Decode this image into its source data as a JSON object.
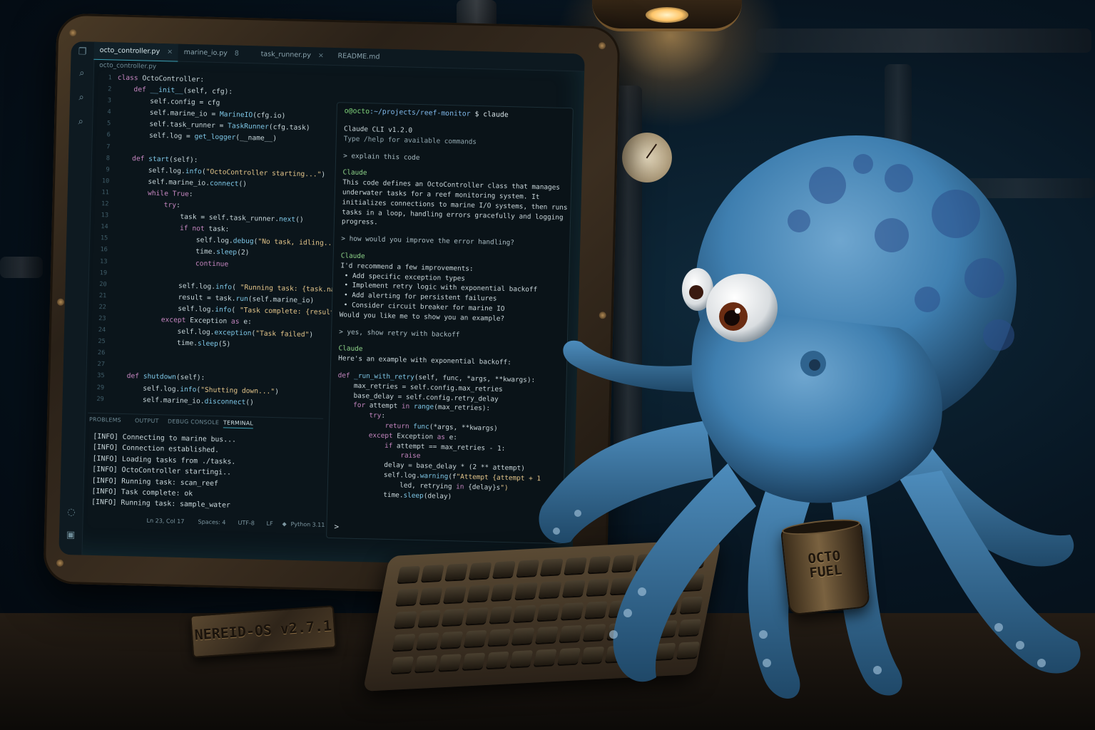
{
  "editor": {
    "tabs": [
      {
        "label": "octo_controller.py",
        "active": true,
        "close": "×"
      },
      {
        "label": "marine_io.py",
        "active": false,
        "close": "8"
      },
      {
        "label": "task_runner.py",
        "active": false,
        "close": "×"
      },
      {
        "label": "README.md",
        "active": false,
        "close": ""
      }
    ],
    "breadcrumb": "octo_controller.py",
    "line_numbers": [
      "1",
      "2",
      "3",
      "4",
      "5",
      "6",
      "7",
      "8",
      "9",
      "10",
      "11",
      "12",
      "13",
      "14",
      "15",
      "16",
      "13",
      "19",
      "20",
      "21",
      "22",
      "23",
      "24",
      "25",
      "26",
      "27",
      "35",
      "29",
      "29"
    ],
    "code_lines": [
      "class OctoController:",
      "    def __init__(self, cfg):",
      "        self.config = cfg",
      "        self.marine_io = MarineIO(cfg.io)",
      "        self.task_runner = TaskRunner(cfg.task)",
      "        self.log = get_logger(__name__)",
      "",
      "    def start(self):",
      "        self.log.info(\"OctoController starting...\")",
      "        self.marine_io.connect()",
      "        while True:",
      "            try:",
      "                task = self.task_runner.next()",
      "                if not task:",
      "                    self.log.debug(\"No task, idling...\")",
      "                    time.sleep(2)",
      "                    continue",
      "",
      "                self.log.info( \"Running task: {task.name}\")",
      "                result = task.run(self.marine_io)",
      "                self.log.info( \"Task complete: {result}\")",
      "            except Exception as e:",
      "                self.log.exception(\"Task failed\")",
      "                time.sleep(5)",
      "",
      "",
      "    def shutdown(self):",
      "        self.log.info(\"Shutting down...\")",
      "        self.marine_io.disconnect()"
    ],
    "panel_tabs": [
      {
        "label": "PROBLEMS",
        "active": false
      },
      {
        "label": "OUTPUT",
        "active": false
      },
      {
        "label": "DEBUG CONSOLE",
        "active": false
      },
      {
        "label": "TERMINAL",
        "active": true
      }
    ],
    "terminal_lines": [
      "[INFO] Connecting to marine bus...",
      "[INFO] Connection established.",
      "[INFO] Loading tasks from ./tasks.",
      "[INFO] OctoController startingi..",
      "[INFO] Running task: scan_reef",
      "[INFO] Task complete: ok",
      "[INFO] Running task: sample_water"
    ],
    "status": {
      "position": "Ln 23, Col 17",
      "spaces": "Spaces: 4",
      "encoding": "UTF-8",
      "eol": "LF",
      "language": "Python",
      "version": "3.11"
    }
  },
  "cli": {
    "prompt_user": "o@octo",
    "prompt_path": ":~/projects/reef-monitor",
    "prompt_cmd": " $ claude",
    "lines": [
      {
        "text": "Claude CLI v1.2.0",
        "kind": "plain"
      },
      {
        "text": "Type /help for available commands",
        "kind": "dim"
      },
      {
        "text": "",
        "kind": "gap"
      },
      {
        "text": "> explain this code",
        "kind": "user"
      },
      {
        "text": "",
        "kind": "gap"
      },
      {
        "text": "Claude",
        "kind": "speaker"
      },
      {
        "text": "This code defines an OctoController class that manages",
        "kind": "plain"
      },
      {
        "text": "underwater tasks for a reef monitoring system. It",
        "kind": "plain"
      },
      {
        "text": "initializes connections to marine I/O systems, then runs",
        "kind": "plain"
      },
      {
        "text": "tasks in a loop, handling errors gracefully and logging",
        "kind": "plain"
      },
      {
        "text": "progress.",
        "kind": "plain"
      },
      {
        "text": "",
        "kind": "gap"
      },
      {
        "text": "> how would you improve the error handling?",
        "kind": "user"
      },
      {
        "text": "",
        "kind": "gap"
      },
      {
        "text": "Claude",
        "kind": "speaker"
      },
      {
        "text": "I'd recommend a few improvements:",
        "kind": "plain"
      },
      {
        "text": " • Add specific exception types",
        "kind": "plain"
      },
      {
        "text": " • Implement retry logic with exponential backoff",
        "kind": "plain"
      },
      {
        "text": " • Add alerting for persistent failures",
        "kind": "plain"
      },
      {
        "text": " • Consider circuit breaker for marine IO",
        "kind": "plain"
      },
      {
        "text": "Would you like me to show you an example?",
        "kind": "plain"
      },
      {
        "text": "",
        "kind": "gap"
      },
      {
        "text": "> yes, show retry with backoff",
        "kind": "user"
      },
      {
        "text": "",
        "kind": "gap"
      },
      {
        "text": "Claude",
        "kind": "speaker"
      },
      {
        "text": "Here's an example with exponential backoff:",
        "kind": "plain"
      },
      {
        "text": "",
        "kind": "gap"
      },
      {
        "text": "def _run_with_retry(self, func, *args, **kwargs):",
        "kind": "code"
      },
      {
        "text": "    max_retries = self.config.max_retries",
        "kind": "code"
      },
      {
        "text": "    base_delay = self.config.retry_delay",
        "kind": "code"
      },
      {
        "text": "    for attempt in range(max_retries):",
        "kind": "code"
      },
      {
        "text": "        try:",
        "kind": "code"
      },
      {
        "text": "            return func(*args, **kwargs)",
        "kind": "code"
      },
      {
        "text": "        except Exception as e:",
        "kind": "code"
      },
      {
        "text": "            if attempt == max_retries - 1:",
        "kind": "code"
      },
      {
        "text": "                raise",
        "kind": "code"
      },
      {
        "text": "            delay = base_delay * (2 ** attempt)",
        "kind": "code"
      },
      {
        "text": "            self.log.warning(f\"Attempt {attempt + 1",
        "kind": "code"
      },
      {
        "text": "                led, retrying in {delay}s\")",
        "kind": "code"
      },
      {
        "text": "            time.sleep(delay)",
        "kind": "code"
      }
    ],
    "cursor": ">"
  },
  "nameplate": "NEREID-OS v2.7.1",
  "mug": "OCTO\nFUEL",
  "colors": {
    "keyword": "#c586c0",
    "function": "#7fc8e8",
    "string": "#e3c58a",
    "prompt_green": "#7fd37a",
    "prompt_blue": "#7fb7e8",
    "claude_green": "#8fd48a",
    "octopus": "#3f7fb0"
  }
}
